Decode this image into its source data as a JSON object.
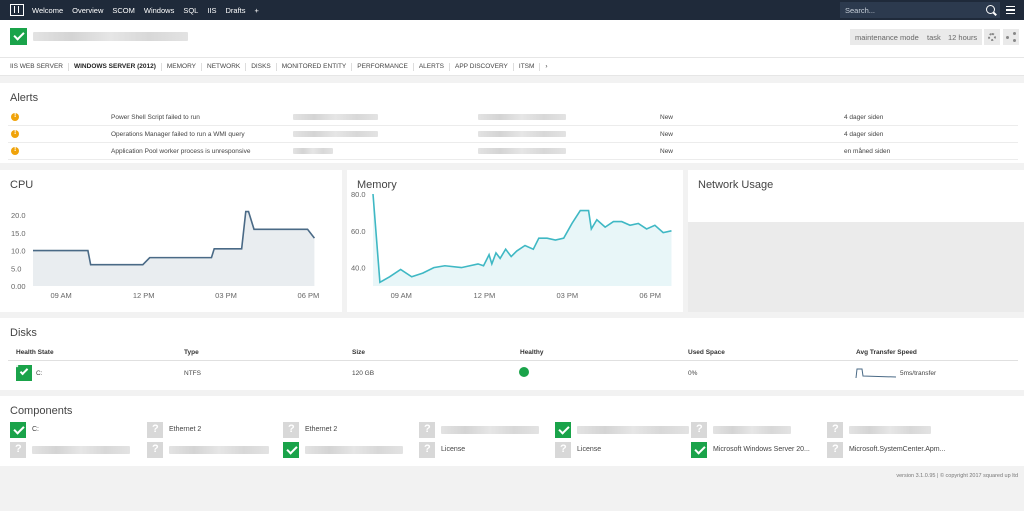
{
  "topnav": {
    "items": [
      "Welcome",
      "Overview",
      "SCOM",
      "Windows",
      "SQL",
      "IIS",
      "Drafts",
      "+"
    ],
    "search_placeholder": "Search..."
  },
  "header": {
    "buttons": {
      "maintenance": "maintenance mode",
      "task": "task",
      "timerange": "12 hours"
    }
  },
  "tabs": [
    "IIS WEB SERVER",
    "WINDOWS SERVER (2012)",
    "MEMORY",
    "NETWORK",
    "DISKS",
    "MONITORED ENTITY",
    "PERFORMANCE",
    "ALERTS",
    "APP DISCOVERY",
    "ITSM",
    "›"
  ],
  "alerts": {
    "title": "Alerts",
    "rows": [
      {
        "name": "Power Shell Script failed to run",
        "state": "New",
        "time": "4 dager siden"
      },
      {
        "name": "Operations Manager failed to run a WMI query",
        "state": "New",
        "time": "4 dager siden"
      },
      {
        "name": "Application Pool worker process is unresponsive",
        "state": "New",
        "time": "en måned siden"
      }
    ]
  },
  "charts": {
    "cpu_title": "CPU",
    "memory_title": "Memory",
    "network_title": "Network Usage"
  },
  "chart_data": [
    {
      "type": "area",
      "title": "CPU",
      "x_ticks": [
        "09 AM",
        "12 PM",
        "03 PM",
        "06 PM"
      ],
      "y_ticks": [
        "0.00",
        "5.0",
        "10.0",
        "15.0",
        "20.0"
      ],
      "ylim": [
        0,
        22
      ],
      "x_hours": [
        8.0,
        8.05,
        10.0,
        10.1,
        12.0,
        12.25,
        14.5,
        14.6,
        15.6,
        15.75,
        15.85,
        16.05,
        18.0,
        18.25
      ],
      "values": [
        10.0,
        10.0,
        10.0,
        6.0,
        6.0,
        8.0,
        8.0,
        10.5,
        10.5,
        21.0,
        21.0,
        16.0,
        16.0,
        13.5
      ],
      "color": "#4a6a86"
    },
    {
      "type": "area",
      "title": "Memory",
      "x_ticks": [
        "09 AM",
        "12 PM",
        "03 PM",
        "06 PM"
      ],
      "y_ticks": [
        "40.0",
        "60.0",
        "80.0"
      ],
      "ylim": [
        30,
        80
      ],
      "x_hours": [
        8.0,
        8.25,
        8.6,
        9.0,
        9.4,
        9.8,
        10.2,
        10.6,
        11.2,
        11.8,
        12.0,
        12.2,
        12.3,
        12.45,
        12.6,
        12.8,
        13.0,
        13.2,
        13.5,
        13.8,
        14.0,
        14.3,
        14.6,
        14.9,
        15.2,
        15.5,
        15.8,
        15.9,
        16.1,
        16.4,
        16.7,
        17.0,
        17.3,
        17.6,
        17.9,
        18.2,
        18.5,
        18.8
      ],
      "values": [
        80,
        32,
        35,
        39,
        35,
        37,
        40,
        41,
        40,
        42,
        41,
        47,
        42,
        48,
        45,
        50,
        46,
        49,
        52,
        50,
        56,
        56,
        55,
        56,
        64,
        71,
        71,
        61,
        66,
        62,
        65,
        65,
        63,
        64,
        61,
        63,
        59,
        60
      ],
      "color": "#3fb8c4"
    }
  ],
  "disks": {
    "title": "Disks",
    "headers": [
      "Health State",
      "Type",
      "Size",
      "Healthy",
      "Used Space",
      "Avg Transfer Speed"
    ],
    "row": {
      "name": "C:",
      "type": "NTFS",
      "size": "120 GB",
      "used": "0%",
      "speed": "5ms/transfer"
    }
  },
  "components": {
    "title": "Components",
    "items": [
      {
        "status": "ok",
        "label": "C:"
      },
      {
        "status": "unknown",
        "label": "Ethernet 2"
      },
      {
        "status": "unknown",
        "label": "Ethernet 2"
      },
      {
        "status": "unknown",
        "label": ""
      },
      {
        "status": "ok",
        "label": ""
      },
      {
        "status": "unknown",
        "label": ""
      },
      {
        "status": "unknown",
        "label": ""
      },
      {
        "status": "unknown",
        "label": ""
      },
      {
        "status": "unknown",
        "label": ""
      },
      {
        "status": "ok",
        "label": ""
      },
      {
        "status": "unknown",
        "label": "License"
      },
      {
        "status": "unknown",
        "label": "License"
      },
      {
        "status": "ok",
        "label": "Microsoft Windows Server 20..."
      },
      {
        "status": "unknown",
        "label": "Microsoft.SystemCenter.Apm..."
      }
    ]
  },
  "footer": "version 3.1.0.95 | © copyright 2017 squared up ltd"
}
